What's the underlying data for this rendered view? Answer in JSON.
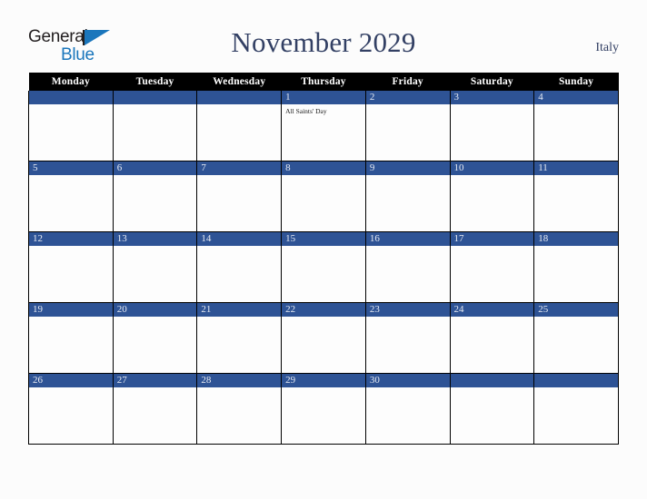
{
  "brand": {
    "name_part1": "General",
    "name_part2": "Blue",
    "flag_icon": "flag-triangle-icon",
    "accent_color": "#1a76bc"
  },
  "header": {
    "title": "November 2029",
    "country": "Italy",
    "title_color": "#334064"
  },
  "calendar": {
    "weekday_headers": [
      "Monday",
      "Tuesday",
      "Wednesday",
      "Thursday",
      "Friday",
      "Saturday",
      "Sunday"
    ],
    "header_bg": "#000000",
    "daynum_band_color": "#2e5395",
    "weeks": [
      [
        {
          "day": "",
          "events": []
        },
        {
          "day": "",
          "events": []
        },
        {
          "day": "",
          "events": []
        },
        {
          "day": "1",
          "events": [
            "All Saints' Day"
          ]
        },
        {
          "day": "2",
          "events": []
        },
        {
          "day": "3",
          "events": []
        },
        {
          "day": "4",
          "events": []
        }
      ],
      [
        {
          "day": "5",
          "events": []
        },
        {
          "day": "6",
          "events": []
        },
        {
          "day": "7",
          "events": []
        },
        {
          "day": "8",
          "events": []
        },
        {
          "day": "9",
          "events": []
        },
        {
          "day": "10",
          "events": []
        },
        {
          "day": "11",
          "events": []
        }
      ],
      [
        {
          "day": "12",
          "events": []
        },
        {
          "day": "13",
          "events": []
        },
        {
          "day": "14",
          "events": []
        },
        {
          "day": "15",
          "events": []
        },
        {
          "day": "16",
          "events": []
        },
        {
          "day": "17",
          "events": []
        },
        {
          "day": "18",
          "events": []
        }
      ],
      [
        {
          "day": "19",
          "events": []
        },
        {
          "day": "20",
          "events": []
        },
        {
          "day": "21",
          "events": []
        },
        {
          "day": "22",
          "events": []
        },
        {
          "day": "23",
          "events": []
        },
        {
          "day": "24",
          "events": []
        },
        {
          "day": "25",
          "events": []
        }
      ],
      [
        {
          "day": "26",
          "events": []
        },
        {
          "day": "27",
          "events": []
        },
        {
          "day": "28",
          "events": []
        },
        {
          "day": "29",
          "events": []
        },
        {
          "day": "30",
          "events": []
        },
        {
          "day": "",
          "events": []
        },
        {
          "day": "",
          "events": []
        }
      ]
    ]
  }
}
